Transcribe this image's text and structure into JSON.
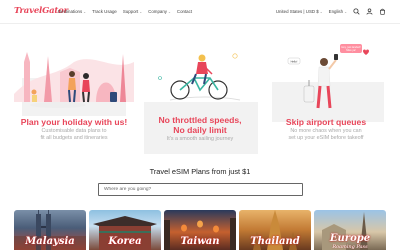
{
  "brand": {
    "logo_text": "TravelGator",
    "accent": "#e8465a"
  },
  "nav": {
    "items": [
      {
        "label": "Destinations",
        "has_dropdown": true
      },
      {
        "label": "Track Usage",
        "has_dropdown": false
      },
      {
        "label": "Support",
        "has_dropdown": true
      },
      {
        "label": "Company",
        "has_dropdown": true
      },
      {
        "label": "Contact",
        "has_dropdown": false
      }
    ],
    "chevron": "⌄"
  },
  "tools": {
    "region": "United States | USD $",
    "language": "English",
    "icons": [
      "search-icon",
      "account-icon",
      "cart-icon"
    ]
  },
  "hero": {
    "cards": [
      {
        "title_lines": [
          "Plan your holiday with us!"
        ],
        "subtitle_lines": [
          "Customisable data plans to",
          "fit all budgets and itineraries"
        ]
      },
      {
        "title_lines": [
          "No throttled speeds,",
          "No daily limit"
        ],
        "subtitle_lines": [
          "It's a smooth sailing journey"
        ]
      },
      {
        "title_lines": [
          "Skip airport queues"
        ],
        "subtitle_lines": [
          "No more chaos when you can",
          "set up your eSIM before takeoff"
        ]
      }
    ],
    "bubble_text": [
      "Hey, just landed!",
      "Miss ya!"
    ],
    "small_bubble": "Hello!"
  },
  "plans": {
    "title": "Travel eSIM Plans from just $1",
    "search_placeholder": "Where are you going?"
  },
  "destinations": [
    {
      "label": "Malaysia",
      "sub": ""
    },
    {
      "label": "Korea",
      "sub": ""
    },
    {
      "label": "Taiwan",
      "sub": ""
    },
    {
      "label": "Thailand",
      "sub": ""
    },
    {
      "label": "Europe",
      "sub": "Roaming Pass"
    }
  ],
  "colors": {
    "card_bg": "#f2f2f2",
    "subtitle": "#a9a9a9",
    "heart": "#e8465a",
    "phone_bubble": "#ff8fa0"
  }
}
